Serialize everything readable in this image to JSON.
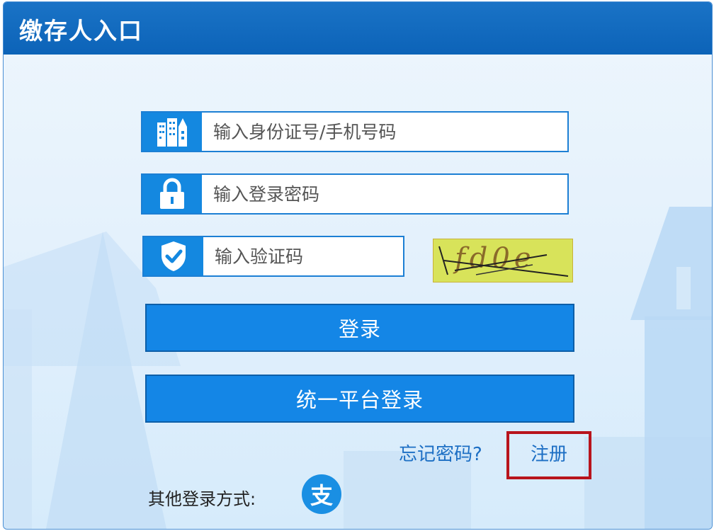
{
  "header": {
    "title": "缴存人入口"
  },
  "form": {
    "id_field": {
      "placeholder": "输入身份证号/手机号码",
      "icon": "building-icon"
    },
    "password_field": {
      "placeholder": "输入登录密码",
      "icon": "lock-icon"
    },
    "captcha_field": {
      "placeholder": "输入验证码",
      "icon": "shield-check-icon"
    },
    "captcha_image": {
      "text": "fd0e"
    }
  },
  "buttons": {
    "login": "登录",
    "unified_login": "统一平台登录"
  },
  "links": {
    "forgot_password": "忘记密码?",
    "register": "注册"
  },
  "other_login": {
    "label": "其他登录方式:",
    "alipay_glyph": "支"
  },
  "colors": {
    "header_bg": "#0c63b8",
    "button_bg": "#1486e6",
    "highlight_border": "#b8141c",
    "link": "#1d6fc4"
  }
}
